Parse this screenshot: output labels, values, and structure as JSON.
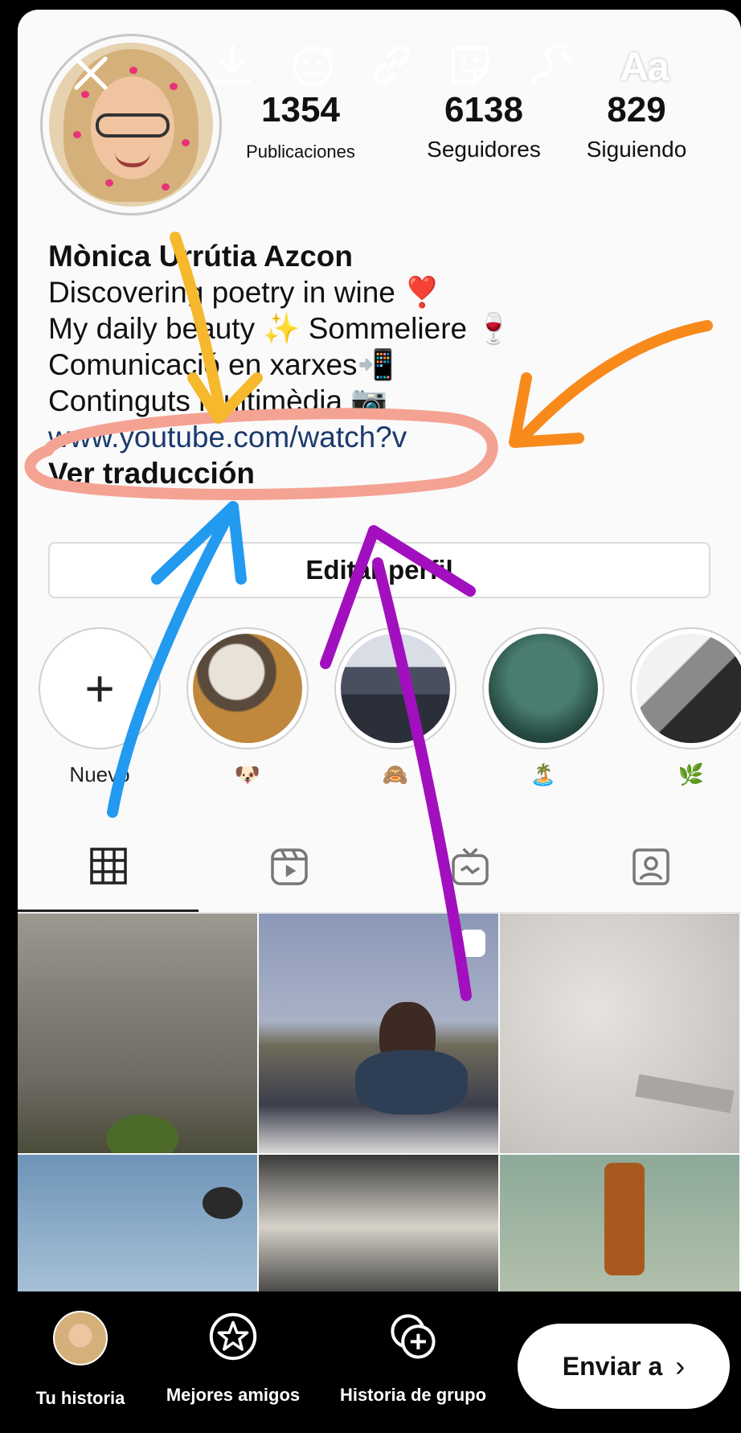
{
  "toolbar": {
    "text_tool_label": "Aa"
  },
  "profile": {
    "stats": [
      {
        "value": "1354",
        "label": "Publicaciones"
      },
      {
        "value": "6138",
        "label": "Seguidores"
      },
      {
        "value": "829",
        "label": "Siguiendo"
      }
    ],
    "name": "Mònica Urrútia Azcon",
    "bio_lines": [
      "Discovering poetry in wine ❣️",
      "My daily beauty ✨ Sommeliere 🍷",
      "Comunicació en xarxes📲",
      "Continguts multimèdia 📷"
    ],
    "link": "www.youtube.com/watch?v",
    "translate_label": "Ver traducción",
    "edit_button": "Editar perfil"
  },
  "highlights": [
    {
      "label": "Nuevo"
    },
    {
      "label": "🐶"
    },
    {
      "label": "🙈"
    },
    {
      "label": "🏝️"
    },
    {
      "label": "🌿"
    }
  ],
  "bottom_bar": {
    "your_story": "Tu historia",
    "close_friends": "Mejores amigos",
    "group_story": "Historia de grupo",
    "send_to": "Enviar a",
    "send_chevron": "›"
  },
  "colors": {
    "annotation_yellow": "#f6b82c",
    "annotation_orange": "#f88a1c",
    "annotation_pink": "#f4a393",
    "annotation_blue": "#229af0",
    "annotation_purple": "#a20fbe"
  }
}
